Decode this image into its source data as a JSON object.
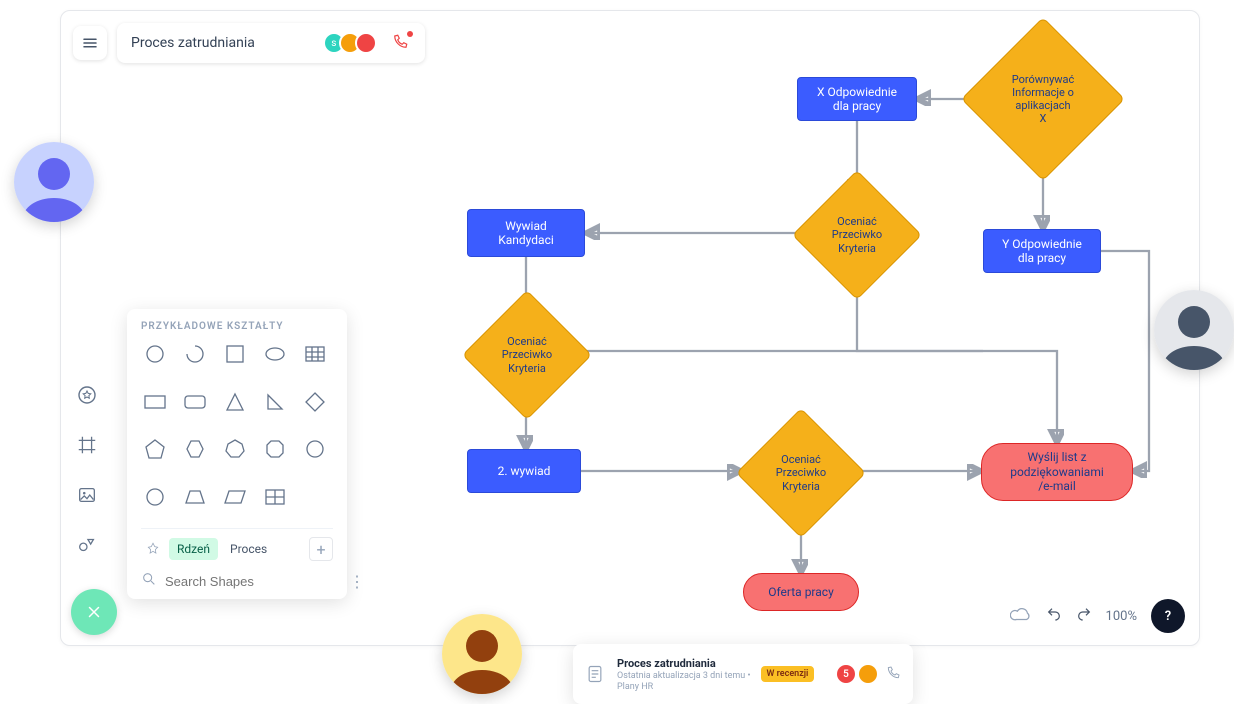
{
  "header": {
    "title": "Proces zatrudniania"
  },
  "shapes_panel": {
    "heading": "PRZYKŁADOWE KSZTAŁTY",
    "tabs": {
      "active": "Rdzeń",
      "other": "Proces"
    },
    "search_placeholder": "Search Shapes"
  },
  "flow": {
    "compare": "Porównywać\nInformacje o\naplikacjach\nX",
    "x_suitable": "X Odpowiednie\ndla pracy",
    "y_suitable": "Y Odpowiednie\ndla pracy",
    "evaluate1": "Oceniać\nPrzeciwko\nKryteria",
    "evaluate2": "Oceniać\nPrzeciwko\nKryteria",
    "evaluate3": "Oceniać\nPrzeciwko\nKryteria",
    "interview": "Wywiad\nKandydaci",
    "second_interview": "2. wywiad",
    "send_thanks": "Wyślij list z\npodziękowaniami\n /e-mail",
    "offer": "Oferta pracy"
  },
  "bottom_card": {
    "title": "Proces zatrudniania",
    "subtitle": "Ostatnia aktualizacja 3 dni temu •",
    "subtitle2": "Plany HR",
    "badge": "W recenzji",
    "count": "5"
  },
  "footer": {
    "zoom": "100%"
  }
}
